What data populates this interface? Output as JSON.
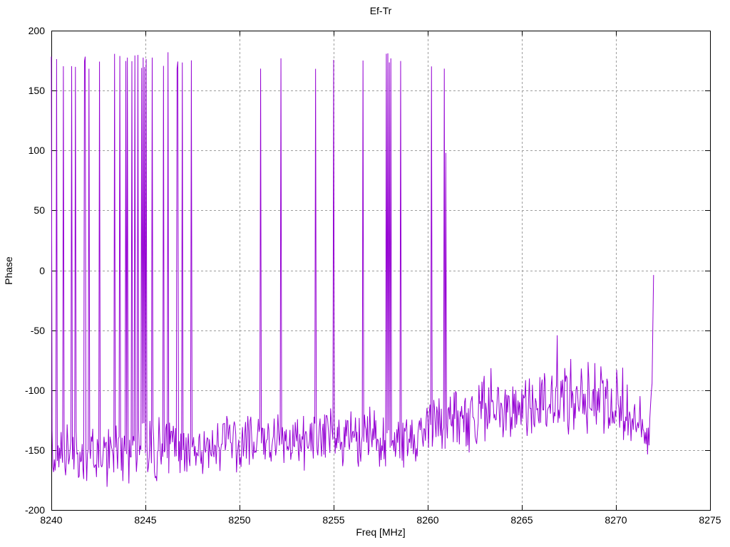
{
  "page": {
    "background": "#ffffff"
  },
  "chart_data": {
    "type": "line",
    "title": "Ef-Tr",
    "xlabel": "Freq [MHz]",
    "ylabel": "Phase",
    "xlim": [
      8240,
      8275
    ],
    "ylim": [
      -200,
      200
    ],
    "xticks": [
      8240,
      8245,
      8250,
      8255,
      8260,
      8265,
      8270,
      8275
    ],
    "xtick_labels": [
      "8240",
      "8245",
      "8250",
      "8255",
      "8260",
      "8265",
      "8270",
      "8275"
    ],
    "yticks": [
      200,
      150,
      100,
      50,
      0,
      -50,
      -100,
      -150,
      -200
    ],
    "ytick_labels": [
      "200",
      "150",
      "100",
      "50",
      "0",
      "-50",
      "-100",
      "-150",
      "-200"
    ],
    "grid": "dashed",
    "legend": "none",
    "grid_color": "#9e9e9e",
    "axis_color": "#000000",
    "line_color": "#9400d3",
    "series": [
      {
        "f_start": 8240.0,
        "f_end": 8272.0,
        "f_step": 0.04,
        "description": "Noisy phase near -150 deg with phase-wrap spikes to +180; noise floor rises to about -110 deg above 8262 MHz; trace ends rising to 0 deg at 8272 MHz",
        "baseline_anchors": [
          [
            8240.0,
            -152
          ],
          [
            8248.0,
            -148
          ],
          [
            8251.0,
            -142
          ],
          [
            8259.0,
            -138
          ],
          [
            8261.0,
            -132
          ],
          [
            8262.5,
            -122
          ],
          [
            8264.0,
            -115
          ],
          [
            8266.0,
            -108
          ],
          [
            8268.0,
            -108
          ],
          [
            8270.0,
            -112
          ],
          [
            8271.3,
            -128
          ],
          [
            8271.7,
            -148
          ],
          [
            8271.92,
            -95
          ],
          [
            8272.0,
            -2
          ]
        ],
        "noise_amp_anchors": [
          [
            8240.0,
            30
          ],
          [
            8259.0,
            28
          ],
          [
            8261.0,
            32
          ],
          [
            8263.0,
            36
          ],
          [
            8268.0,
            36
          ],
          [
            8270.5,
            30
          ],
          [
            8271.8,
            16
          ],
          [
            8272.0,
            4
          ]
        ],
        "wrap_spike_freqs": [
          8240.0,
          8240.26,
          8240.3,
          8240.64,
          8241.08,
          8241.3,
          8241.76,
          8241.8,
          8242.0,
          8242.54,
          8243.38,
          8243.66,
          8243.94,
          8243.98,
          8244.06,
          8244.3,
          8244.44,
          8244.6,
          8244.78,
          8244.82,
          8244.86,
          8244.9,
          8244.94,
          8244.98,
          8245.02,
          8245.34,
          8245.98,
          8246.2,
          8246.68,
          8246.72,
          8246.94,
          8247.46,
          8251.1,
          8252.2,
          8254.04,
          8255.0,
          8256.56,
          8257.78,
          8257.86,
          8257.94,
          8258.02,
          8258.58,
          8260.2,
          8260.9
        ],
        "partial_spikes": [
          [
            8260.94,
            98
          ]
        ],
        "spike_peak_range": [
          168,
          182
        ],
        "noise_floor_min": -186,
        "noise_seed": 20240
      }
    ]
  }
}
